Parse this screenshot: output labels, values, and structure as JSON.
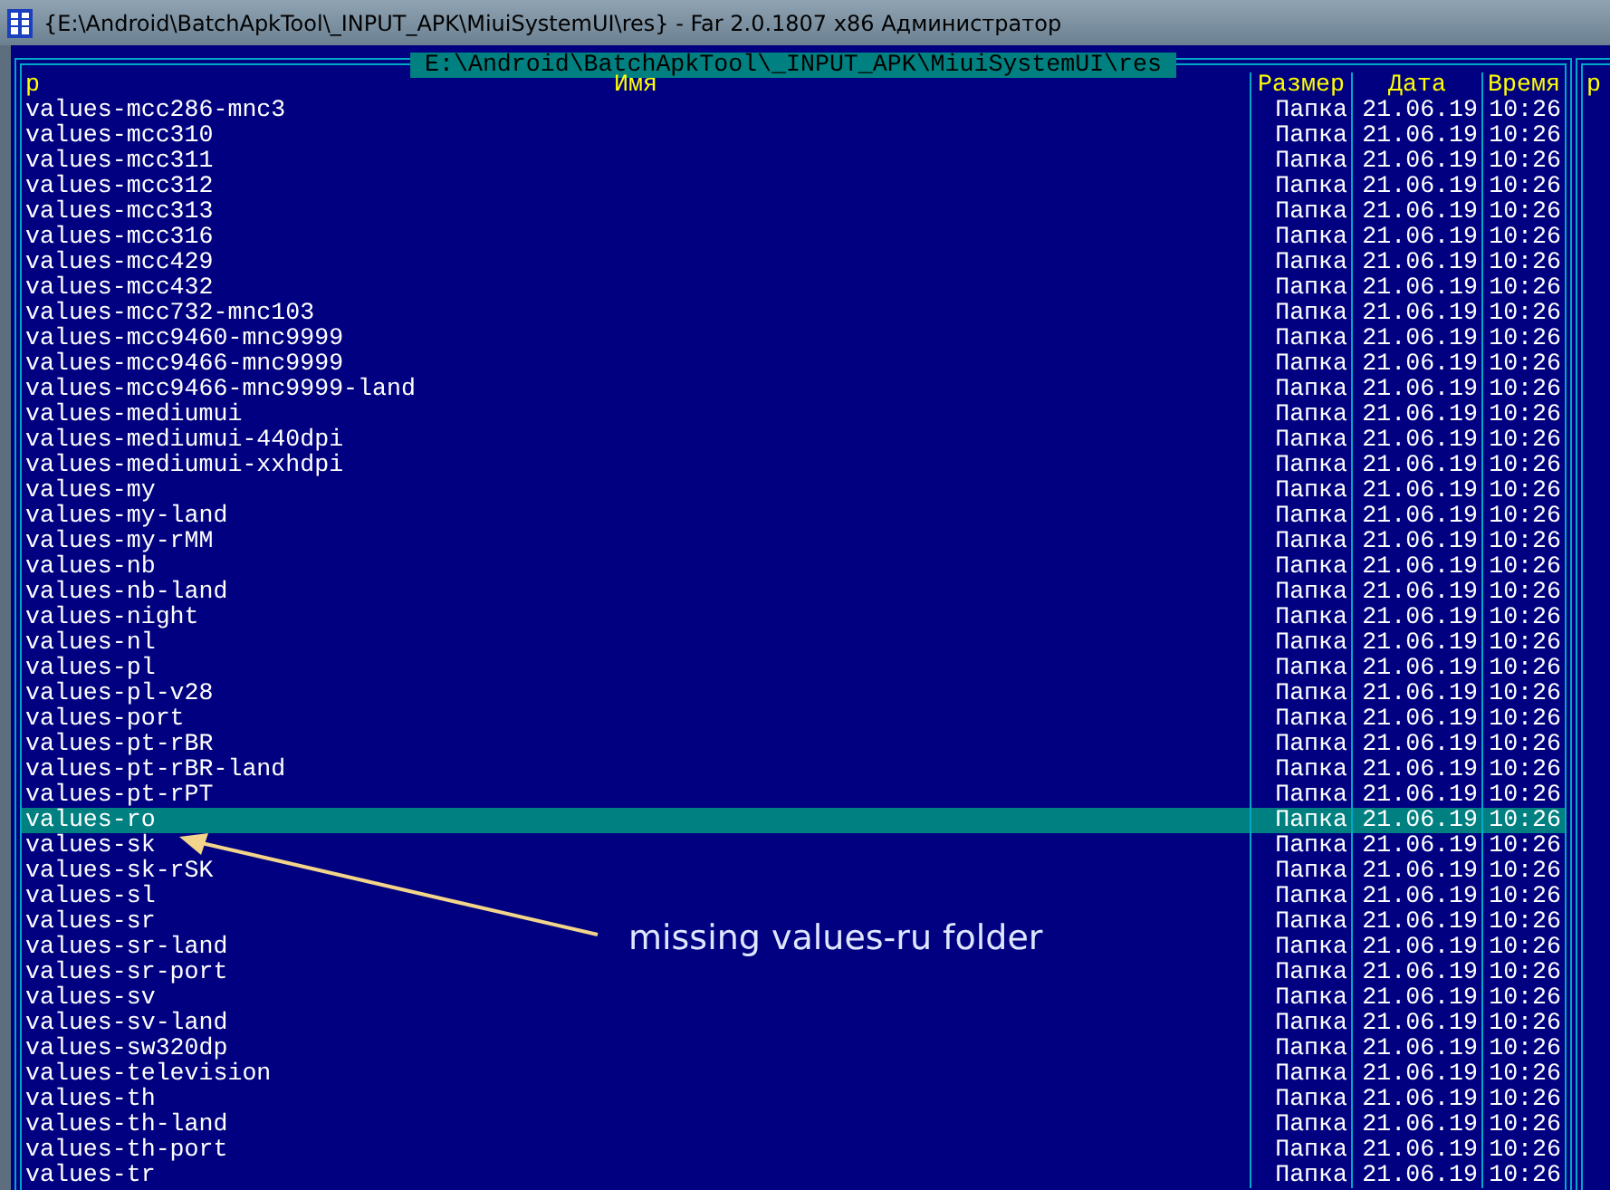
{
  "window": {
    "title": "{E:\\Android\\BatchApkTool\\_INPUT_APK\\MiuiSystemUI\\res} - Far 2.0.1807 x86 Администратор"
  },
  "panel": {
    "path": "E:\\Android\\BatchApkTool\\_INPUT_APK\\MiuiSystemUI\\res",
    "columns": [
      {
        "label": "р",
        "kind": "sort"
      },
      {
        "label": "Имя",
        "kind": "name"
      },
      {
        "label": "Размер",
        "kind": "size"
      },
      {
        "label": "Дата",
        "kind": "date"
      },
      {
        "label": "Время",
        "kind": "time"
      }
    ],
    "rows": [
      {
        "name": "values-mcc286-mnc3",
        "size": "Папка",
        "date": "21.06.19",
        "time": "10:26",
        "selected": false
      },
      {
        "name": "values-mcc310",
        "size": "Папка",
        "date": "21.06.19",
        "time": "10:26",
        "selected": false
      },
      {
        "name": "values-mcc311",
        "size": "Папка",
        "date": "21.06.19",
        "time": "10:26",
        "selected": false
      },
      {
        "name": "values-mcc312",
        "size": "Папка",
        "date": "21.06.19",
        "time": "10:26",
        "selected": false
      },
      {
        "name": "values-mcc313",
        "size": "Папка",
        "date": "21.06.19",
        "time": "10:26",
        "selected": false
      },
      {
        "name": "values-mcc316",
        "size": "Папка",
        "date": "21.06.19",
        "time": "10:26",
        "selected": false
      },
      {
        "name": "values-mcc429",
        "size": "Папка",
        "date": "21.06.19",
        "time": "10:26",
        "selected": false
      },
      {
        "name": "values-mcc432",
        "size": "Папка",
        "date": "21.06.19",
        "time": "10:26",
        "selected": false
      },
      {
        "name": "values-mcc732-mnc103",
        "size": "Папка",
        "date": "21.06.19",
        "time": "10:26",
        "selected": false
      },
      {
        "name": "values-mcc9460-mnc9999",
        "size": "Папка",
        "date": "21.06.19",
        "time": "10:26",
        "selected": false
      },
      {
        "name": "values-mcc9466-mnc9999",
        "size": "Папка",
        "date": "21.06.19",
        "time": "10:26",
        "selected": false
      },
      {
        "name": "values-mcc9466-mnc9999-land",
        "size": "Папка",
        "date": "21.06.19",
        "time": "10:26",
        "selected": false
      },
      {
        "name": "values-mediumui",
        "size": "Папка",
        "date": "21.06.19",
        "time": "10:26",
        "selected": false
      },
      {
        "name": "values-mediumui-440dpi",
        "size": "Папка",
        "date": "21.06.19",
        "time": "10:26",
        "selected": false
      },
      {
        "name": "values-mediumui-xxhdpi",
        "size": "Папка",
        "date": "21.06.19",
        "time": "10:26",
        "selected": false
      },
      {
        "name": "values-my",
        "size": "Папка",
        "date": "21.06.19",
        "time": "10:26",
        "selected": false
      },
      {
        "name": "values-my-land",
        "size": "Папка",
        "date": "21.06.19",
        "time": "10:26",
        "selected": false
      },
      {
        "name": "values-my-rMM",
        "size": "Папка",
        "date": "21.06.19",
        "time": "10:26",
        "selected": false
      },
      {
        "name": "values-nb",
        "size": "Папка",
        "date": "21.06.19",
        "time": "10:26",
        "selected": false
      },
      {
        "name": "values-nb-land",
        "size": "Папка",
        "date": "21.06.19",
        "time": "10:26",
        "selected": false
      },
      {
        "name": "values-night",
        "size": "Папка",
        "date": "21.06.19",
        "time": "10:26",
        "selected": false
      },
      {
        "name": "values-nl",
        "size": "Папка",
        "date": "21.06.19",
        "time": "10:26",
        "selected": false
      },
      {
        "name": "values-pl",
        "size": "Папка",
        "date": "21.06.19",
        "time": "10:26",
        "selected": false
      },
      {
        "name": "values-pl-v28",
        "size": "Папка",
        "date": "21.06.19",
        "time": "10:26",
        "selected": false
      },
      {
        "name": "values-port",
        "size": "Папка",
        "date": "21.06.19",
        "time": "10:26",
        "selected": false
      },
      {
        "name": "values-pt-rBR",
        "size": "Папка",
        "date": "21.06.19",
        "time": "10:26",
        "selected": false
      },
      {
        "name": "values-pt-rBR-land",
        "size": "Папка",
        "date": "21.06.19",
        "time": "10:26",
        "selected": false
      },
      {
        "name": "values-pt-rPT",
        "size": "Папка",
        "date": "21.06.19",
        "time": "10:26",
        "selected": false
      },
      {
        "name": "values-ro",
        "size": "Папка",
        "date": "21.06.19",
        "time": "10:26",
        "selected": true
      },
      {
        "name": "values-sk",
        "size": "Папка",
        "date": "21.06.19",
        "time": "10:26",
        "selected": false
      },
      {
        "name": "values-sk-rSK",
        "size": "Папка",
        "date": "21.06.19",
        "time": "10:26",
        "selected": false
      },
      {
        "name": "values-sl",
        "size": "Папка",
        "date": "21.06.19",
        "time": "10:26",
        "selected": false
      },
      {
        "name": "values-sr",
        "size": "Папка",
        "date": "21.06.19",
        "time": "10:26",
        "selected": false
      },
      {
        "name": "values-sr-land",
        "size": "Папка",
        "date": "21.06.19",
        "time": "10:26",
        "selected": false
      },
      {
        "name": "values-sr-port",
        "size": "Папка",
        "date": "21.06.19",
        "time": "10:26",
        "selected": false
      },
      {
        "name": "values-sv",
        "size": "Папка",
        "date": "21.06.19",
        "time": "10:26",
        "selected": false
      },
      {
        "name": "values-sv-land",
        "size": "Папка",
        "date": "21.06.19",
        "time": "10:26",
        "selected": false
      },
      {
        "name": "values-sw320dp",
        "size": "Папка",
        "date": "21.06.19",
        "time": "10:26",
        "selected": false
      },
      {
        "name": "values-television",
        "size": "Папка",
        "date": "21.06.19",
        "time": "10:26",
        "selected": false
      },
      {
        "name": "values-th",
        "size": "Папка",
        "date": "21.06.19",
        "time": "10:26",
        "selected": false
      },
      {
        "name": "values-th-land",
        "size": "Папка",
        "date": "21.06.19",
        "time": "10:26",
        "selected": false
      },
      {
        "name": "values-th-port",
        "size": "Папка",
        "date": "21.06.19",
        "time": "10:26",
        "selected": false
      },
      {
        "name": "values-tr",
        "size": "Папка",
        "date": "21.06.19",
        "time": "10:26",
        "selected": false
      }
    ]
  },
  "right_panel": {
    "column_1": "р"
  },
  "annotation": {
    "text": "missing values-ru folder"
  }
}
